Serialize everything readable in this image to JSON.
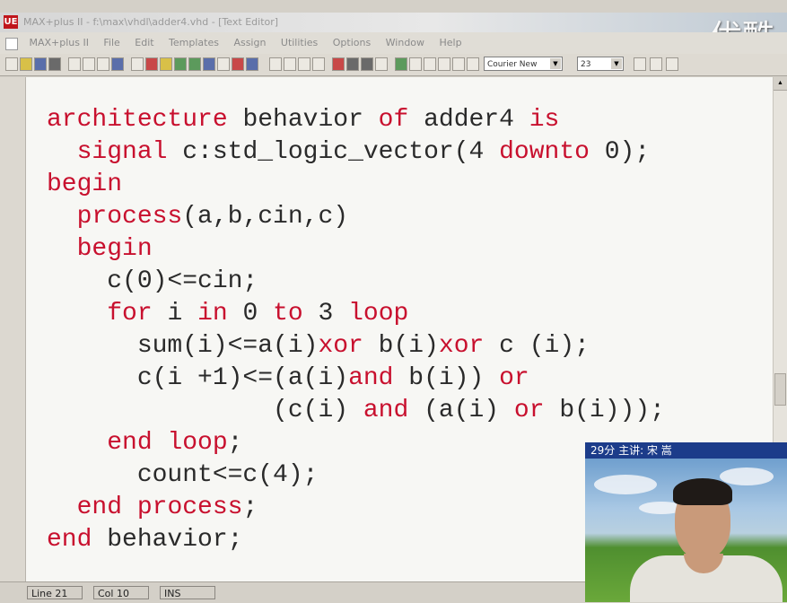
{
  "window": {
    "app_icon_label": "UE",
    "title": "MAX+plus II - f:\\max\\vhdl\\adder4.vhd - [Text Editor]"
  },
  "watermark": "优酷",
  "menubar": {
    "items": [
      "MAX+plus II",
      "File",
      "Edit",
      "Templates",
      "Assign",
      "Utilities",
      "Options",
      "Window",
      "Help"
    ]
  },
  "toolbar": {
    "font_name": "Courier New",
    "font_size": "23"
  },
  "code_lines": [
    [
      {
        "t": "architecture",
        "kw": true
      },
      {
        "t": " behavior ",
        "kw": false
      },
      {
        "t": "of",
        "kw": true
      },
      {
        "t": " adder4 ",
        "kw": false
      },
      {
        "t": "is",
        "kw": true
      }
    ],
    [
      {
        "t": "  ",
        "kw": false
      },
      {
        "t": "signal",
        "kw": true
      },
      {
        "t": " c:std_logic_vector(4 ",
        "kw": false
      },
      {
        "t": "downto",
        "kw": true
      },
      {
        "t": " 0);",
        "kw": false
      }
    ],
    [
      {
        "t": "begin",
        "kw": true
      }
    ],
    [
      {
        "t": "  ",
        "kw": false
      },
      {
        "t": "process",
        "kw": true
      },
      {
        "t": "(a,b,cin,c)",
        "kw": false
      }
    ],
    [
      {
        "t": "  ",
        "kw": false
      },
      {
        "t": "begin",
        "kw": true
      }
    ],
    [
      {
        "t": "    c(0)<=cin;",
        "kw": false
      }
    ],
    [
      {
        "t": "    ",
        "kw": false
      },
      {
        "t": "for",
        "kw": true
      },
      {
        "t": " i ",
        "kw": false
      },
      {
        "t": "in",
        "kw": true
      },
      {
        "t": " 0 ",
        "kw": false
      },
      {
        "t": "to",
        "kw": true
      },
      {
        "t": " 3 ",
        "kw": false
      },
      {
        "t": "loop",
        "kw": true
      }
    ],
    [
      {
        "t": "      sum(i)<=a(i)",
        "kw": false
      },
      {
        "t": "xor",
        "kw": true
      },
      {
        "t": " b(i)",
        "kw": false
      },
      {
        "t": "xor",
        "kw": true
      },
      {
        "t": " c (i);",
        "kw": false
      }
    ],
    [
      {
        "t": "      c(i +1)<=(a(i)",
        "kw": false
      },
      {
        "t": "and",
        "kw": true
      },
      {
        "t": " b(i)) ",
        "kw": false
      },
      {
        "t": "or",
        "kw": true
      }
    ],
    [
      {
        "t": "               (c(i) ",
        "kw": false
      },
      {
        "t": "and",
        "kw": true
      },
      {
        "t": " (a(i) ",
        "kw": false
      },
      {
        "t": "or",
        "kw": true
      },
      {
        "t": " b(i)));",
        "kw": false
      }
    ],
    [
      {
        "t": "    ",
        "kw": false
      },
      {
        "t": "end",
        "kw": true
      },
      {
        "t": " ",
        "kw": false
      },
      {
        "t": "loop",
        "kw": true
      },
      {
        "t": ";",
        "kw": false
      }
    ],
    [
      {
        "t": "      count<=c(4);",
        "kw": false
      }
    ],
    [
      {
        "t": "  ",
        "kw": false
      },
      {
        "t": "end",
        "kw": true
      },
      {
        "t": " ",
        "kw": false
      },
      {
        "t": "process",
        "kw": true
      },
      {
        "t": ";",
        "kw": false
      }
    ],
    [
      {
        "t": "end",
        "kw": true
      },
      {
        "t": " behavior;",
        "kw": false
      }
    ]
  ],
  "statusbar": {
    "line": "Line 21",
    "col": "Col 10",
    "mode": "INS"
  },
  "video": {
    "caption": "29分 主讲: 宋 嵩"
  },
  "colors": {
    "keyword": "#c8102e",
    "text": "#2a2a2a",
    "editor_bg": "#f7f7f4",
    "video_caption_bg": "#1c3c8a"
  }
}
